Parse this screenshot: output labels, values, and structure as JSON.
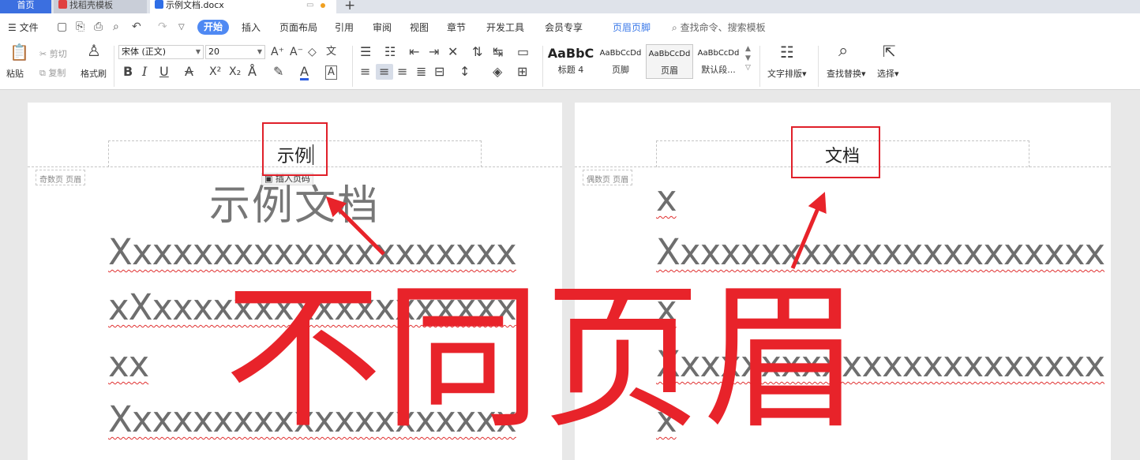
{
  "tabs": [
    {
      "label": "首页"
    },
    {
      "label": "找稻壳模板"
    },
    {
      "label": "示例文档.docx"
    }
  ],
  "menu": {
    "file": "文件",
    "items": [
      "开始",
      "插入",
      "页面布局",
      "引用",
      "审阅",
      "视图",
      "章节",
      "开发工具",
      "会员专享",
      "页眉页脚"
    ],
    "search": "查找命令、搜索模板"
  },
  "ribbon": {
    "paste": "粘贴",
    "cut": "剪切",
    "copy": "复制",
    "format_painter": "格式刷",
    "font_name": "宋体 (正文)",
    "font_size": "20",
    "styles": [
      {
        "sample": "AaBbC",
        "name": "标题 4"
      },
      {
        "sample": "AaBbCcDd",
        "name": "页脚"
      },
      {
        "sample": "AaBbCcDd",
        "name": "页眉"
      },
      {
        "sample": "AaBbCcDd",
        "name": "默认段..."
      }
    ],
    "text_layout": "文字排版",
    "find_replace": "查找替换",
    "select": "选择"
  },
  "left_page": {
    "header_tag": "奇数页 页眉",
    "header_text": "示例",
    "insert_page_number": "插入页码",
    "title": "示例文档",
    "lines": [
      "Xxxxxxxxxxxxxxxxxxxx",
      "xXxxxxxxxxxxxxxxxxxx",
      "xx",
      "Xxxxxxxxxxxxxxxxxxxx"
    ]
  },
  "right_page": {
    "header_tag": "偶数页 页眉",
    "header_text": "文档",
    "lines": [
      "x",
      "Xxxxxxxxxxxxxxxxxxxxxx",
      "x",
      "Xxxxxxxxxxxxxxxxxxxxxx",
      "x"
    ]
  },
  "overlay_text": "不同页眉",
  "colors": {
    "accent": "#4f89f3",
    "annotation": "#e8232a"
  }
}
